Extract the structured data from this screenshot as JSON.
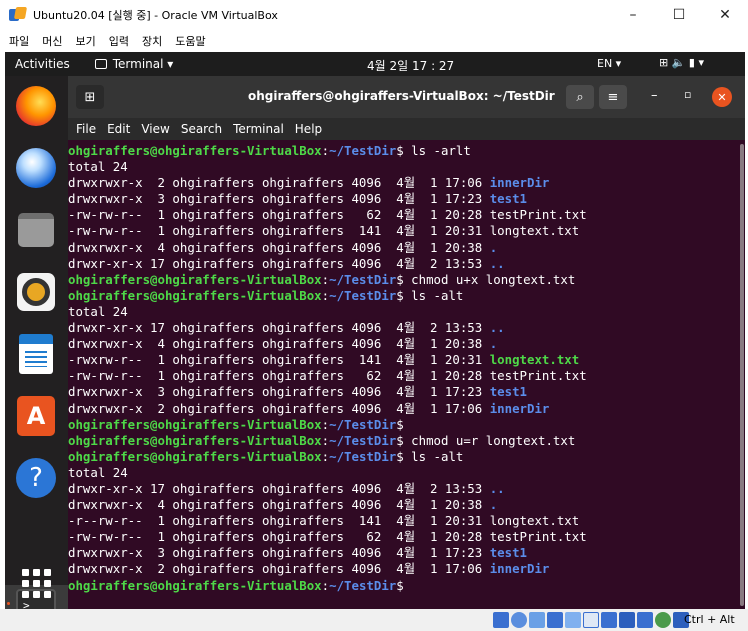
{
  "vbox": {
    "title": "Ubuntu20.04 [실행 중] - Oracle VM VirtualBox",
    "menu": [
      "파일",
      "머신",
      "보기",
      "입력",
      "장치",
      "도움말"
    ],
    "win_min": "–",
    "win_max": "☐",
    "win_close": "✕",
    "host_key": "Ctrl + Alt"
  },
  "topbar": {
    "activities": "Activities",
    "app_menu": "Terminal ▾",
    "clock": "4월 2일 17 : 27",
    "lang": "EN ▾",
    "status_icons": "⊞  🔈  ▮  ▾"
  },
  "dock": {
    "items": [
      "firefox-icon",
      "thunderbird-icon",
      "files-icon",
      "rhythmbox-icon",
      "libreoffice-writer-icon",
      "ubuntu-software-icon",
      "help-icon",
      "terminal-icon",
      "show-applications-icon"
    ],
    "help_glyph": "?",
    "software_glyph": "A",
    "terminal_glyph": ">_"
  },
  "terminal": {
    "title": "ohgiraffers@ohgiraffers-VirtualBox: ~/TestDir",
    "menu": [
      "File",
      "Edit",
      "View",
      "Search",
      "Terminal",
      "Help"
    ],
    "prompt_user": "ohgiraffers@ohgiraffers-VirtualBox",
    "prompt_path": "~/TestDir",
    "lines": [
      {
        "type": "prompt",
        "cmd": " ls -arlt"
      },
      {
        "type": "text",
        "text": "total 24"
      },
      {
        "type": "entry",
        "prefix": "drwxrwxr-x  2 ohgiraffers ohgiraffers 4096  4월  1 17:06 ",
        "name": "innerDir",
        "style": "dir"
      },
      {
        "type": "entry",
        "prefix": "drwxrwxr-x  3 ohgiraffers ohgiraffers 4096  4월  1 17:23 ",
        "name": "test1",
        "style": "dir"
      },
      {
        "type": "entry",
        "prefix": "-rw-rw-r--  1 ohgiraffers ohgiraffers   62  4월  1 20:28 ",
        "name": "testPrint.txt",
        "style": "plain"
      },
      {
        "type": "entry",
        "prefix": "-rw-rw-r--  1 ohgiraffers ohgiraffers  141  4월  1 20:31 ",
        "name": "longtext.txt",
        "style": "plain"
      },
      {
        "type": "entry",
        "prefix": "drwxrwxr-x  4 ohgiraffers ohgiraffers 4096  4월  1 20:38 ",
        "name": ".",
        "style": "dir"
      },
      {
        "type": "entry",
        "prefix": "drwxr-xr-x 17 ohgiraffers ohgiraffers 4096  4월  2 13:53 ",
        "name": "..",
        "style": "dir"
      },
      {
        "type": "prompt",
        "cmd": " chmod u+x longtext.txt"
      },
      {
        "type": "prompt",
        "cmd": " ls -alt"
      },
      {
        "type": "text",
        "text": "total 24"
      },
      {
        "type": "entry",
        "prefix": "drwxr-xr-x 17 ohgiraffers ohgiraffers 4096  4월  2 13:53 ",
        "name": "..",
        "style": "dir"
      },
      {
        "type": "entry",
        "prefix": "drwxrwxr-x  4 ohgiraffers ohgiraffers 4096  4월  1 20:38 ",
        "name": ".",
        "style": "dir"
      },
      {
        "type": "entry",
        "prefix": "-rwxrw-r--  1 ohgiraffers ohgiraffers  141  4월  1 20:31 ",
        "name": "longtext.txt",
        "style": "exe"
      },
      {
        "type": "entry",
        "prefix": "-rw-rw-r--  1 ohgiraffers ohgiraffers   62  4월  1 20:28 ",
        "name": "testPrint.txt",
        "style": "plain"
      },
      {
        "type": "entry",
        "prefix": "drwxrwxr-x  3 ohgiraffers ohgiraffers 4096  4월  1 17:23 ",
        "name": "test1",
        "style": "dir"
      },
      {
        "type": "entry",
        "prefix": "drwxrwxr-x  2 ohgiraffers ohgiraffers 4096  4월  1 17:06 ",
        "name": "innerDir",
        "style": "dir"
      },
      {
        "type": "prompt",
        "cmd": ""
      },
      {
        "type": "prompt",
        "cmd": " chmod u=r longtext.txt"
      },
      {
        "type": "prompt",
        "cmd": " ls -alt"
      },
      {
        "type": "text",
        "text": "total 24"
      },
      {
        "type": "entry",
        "prefix": "drwxr-xr-x 17 ohgiraffers ohgiraffers 4096  4월  2 13:53 ",
        "name": "..",
        "style": "dir"
      },
      {
        "type": "entry",
        "prefix": "drwxrwxr-x  4 ohgiraffers ohgiraffers 4096  4월  1 20:38 ",
        "name": ".",
        "style": "dir"
      },
      {
        "type": "entry",
        "prefix": "-r--rw-r--  1 ohgiraffers ohgiraffers  141  4월  1 20:31 ",
        "name": "longtext.txt",
        "style": "plain"
      },
      {
        "type": "entry",
        "prefix": "-rw-rw-r--  1 ohgiraffers ohgiraffers   62  4월  1 20:28 ",
        "name": "testPrint.txt",
        "style": "plain"
      },
      {
        "type": "entry",
        "prefix": "drwxrwxr-x  3 ohgiraffers ohgiraffers 4096  4월  1 17:23 ",
        "name": "test1",
        "style": "dir"
      },
      {
        "type": "entry",
        "prefix": "drwxrwxr-x  2 ohgiraffers ohgiraffers 4096  4월  1 17:06 ",
        "name": "innerDir",
        "style": "dir"
      },
      {
        "type": "prompt",
        "cmd": ""
      }
    ]
  },
  "colors": {
    "terminal_bg": "#300a24",
    "prompt_user": "#4ed948",
    "prompt_path": "#5b8dea",
    "ubuntu_orange": "#e95420"
  }
}
